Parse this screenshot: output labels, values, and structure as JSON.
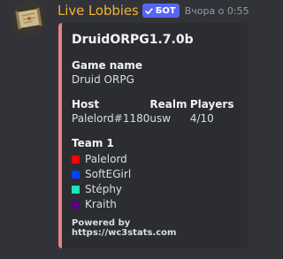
{
  "author": {
    "username": "Live Lobbies",
    "bot_tag": "БОТ",
    "timestamp": "Вчора о 0:55"
  },
  "embed": {
    "accent_color": "#e78284",
    "title": "DruidORPG1.7.0b",
    "game_name": {
      "label": "Game name",
      "value": "Druid ORPG"
    },
    "host": {
      "label": "Host",
      "value": "Palelord#1180"
    },
    "realm": {
      "label": "Realm",
      "value": "usw"
    },
    "players": {
      "label": "Players",
      "value": "4/10"
    },
    "team": {
      "label": "Team 1",
      "members": [
        {
          "name": "Palelord",
          "color": "#ff0303"
        },
        {
          "name": "SoftEGirl",
          "color": "#0042ff"
        },
        {
          "name": "Stéphy",
          "color": "#1ce6b9"
        },
        {
          "name": "Kraith",
          "color": "#540081"
        }
      ]
    },
    "footer": "Powered by https://wc3stats.com"
  }
}
